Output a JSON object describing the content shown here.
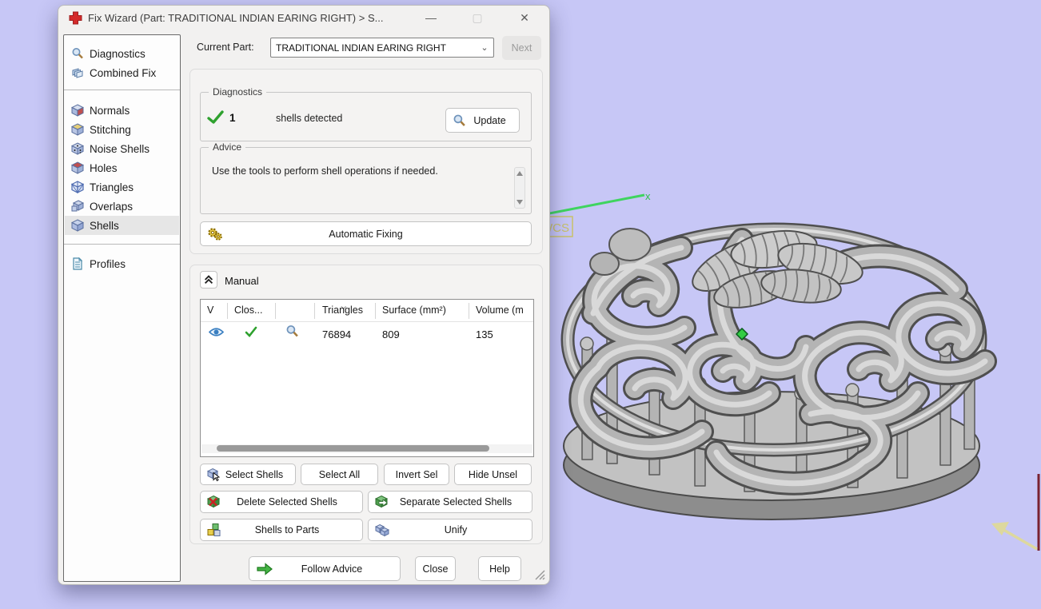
{
  "window": {
    "title": "Fix Wizard (Part: TRADITIONAL INDIAN EARING RIGHT) > S..."
  },
  "current_part": {
    "label": "Current Part:",
    "value": "TRADITIONAL INDIAN EARING RIGHT",
    "next": "Next"
  },
  "sidebar": {
    "items": [
      {
        "label": "Diagnostics"
      },
      {
        "label": "Combined Fix"
      },
      {
        "label": "Normals"
      },
      {
        "label": "Stitching"
      },
      {
        "label": "Noise Shells"
      },
      {
        "label": "Holes"
      },
      {
        "label": "Triangles"
      },
      {
        "label": "Overlaps"
      },
      {
        "label": "Shells"
      },
      {
        "label": "Profiles"
      }
    ],
    "selected": "Shells"
  },
  "diagnostics": {
    "title": "Diagnostics",
    "count": "1",
    "message": "shells detected",
    "update": "Update"
  },
  "advice": {
    "title": "Advice",
    "text": "Use the tools to perform shell operations if needed."
  },
  "automatic_fixing": "Automatic Fixing",
  "manual": {
    "title": "Manual",
    "table": {
      "columns": [
        "V",
        "Clos...",
        "",
        "Triangles",
        "Surface (mm²)",
        "Volume (m"
      ],
      "rows": [
        {
          "visible": true,
          "closed": true,
          "triangles": "76894",
          "surface": "809",
          "volume": "135"
        }
      ]
    },
    "buttons": {
      "select_shells": "Select Shells",
      "select_all": "Select All",
      "invert_sel": "Invert Sel",
      "hide_unsel": "Hide Unsel",
      "delete_selected": "Delete Selected Shells",
      "separate_selected": "Separate Selected Shells",
      "shells_to_parts": "Shells to Parts",
      "unify": "Unify"
    }
  },
  "footer": {
    "follow_advice": "Follow Advice",
    "close": "Close",
    "help": "Help"
  },
  "viewport": {
    "axis_x": "x",
    "wcs": "WCS",
    "background": "#c7c7f6",
    "axis_color": "#3fd45f",
    "model_color": "#b4b4b4"
  }
}
